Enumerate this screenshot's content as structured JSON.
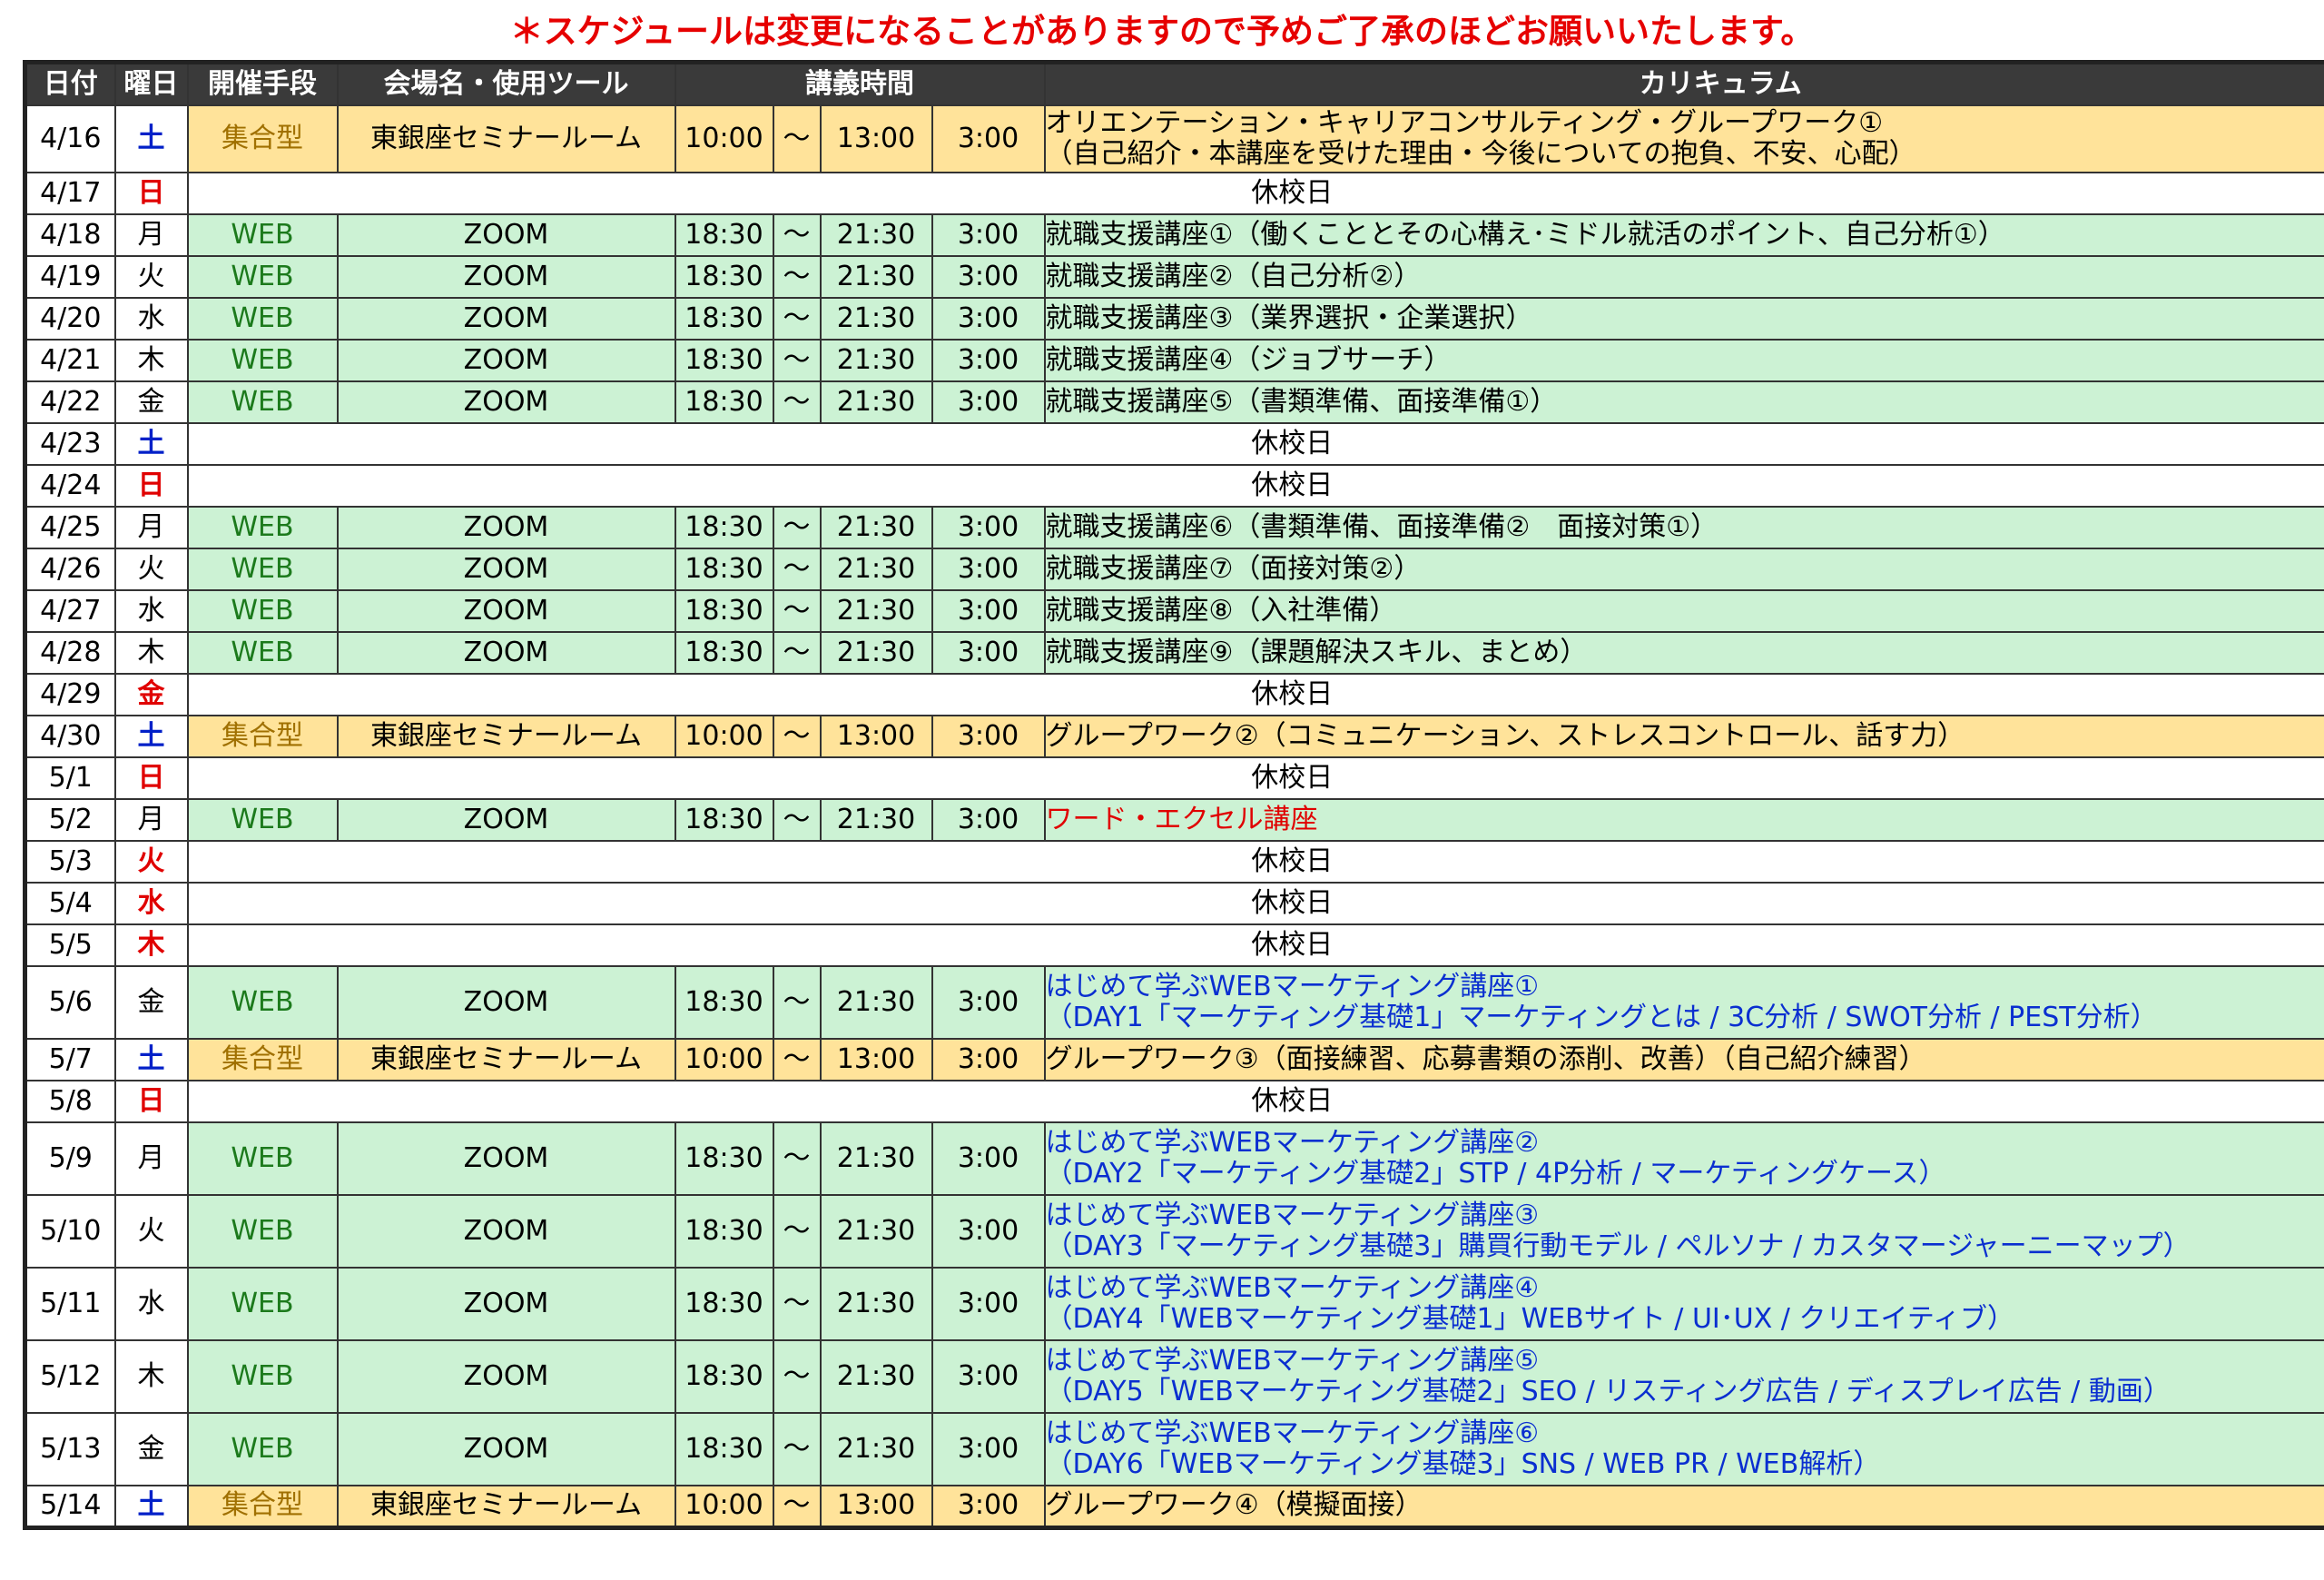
{
  "notice": "＊スケジュールは変更になることがありますので予めご了承のほどお願いいたします。",
  "headers": {
    "date": "日付",
    "day": "曜日",
    "mode": "開催手段",
    "venue": "会場名・使用ツール",
    "time": "講義時間",
    "curriculum": "カリキュラム"
  },
  "rows": [
    {
      "date": "4/16",
      "day": "土",
      "dayType": "sat",
      "type": "meet",
      "mode": "集合型",
      "venue": "東銀座セミナールーム",
      "start": "10:00",
      "tilde": "〜",
      "end": "13:00",
      "dur": "3:00",
      "cur": [
        "オリエンテーション・キャリアコンサルティング・グループワーク①",
        "（自己紹介・本講座を受けた理由・今後についての抱負、不安、心配）"
      ]
    },
    {
      "date": "4/17",
      "day": "日",
      "dayType": "sun",
      "type": "holiday",
      "holiday": "休校日"
    },
    {
      "date": "4/18",
      "day": "月",
      "dayType": "wk",
      "type": "web",
      "mode": "WEB",
      "venue": "ZOOM",
      "start": "18:30",
      "tilde": "〜",
      "end": "21:30",
      "dur": "3:00",
      "cur": [
        "就職支援講座①（働くこととその心構え･ミドル就活のポイント、自己分析①）"
      ]
    },
    {
      "date": "4/19",
      "day": "火",
      "dayType": "wk",
      "type": "web",
      "mode": "WEB",
      "venue": "ZOOM",
      "start": "18:30",
      "tilde": "〜",
      "end": "21:30",
      "dur": "3:00",
      "cur": [
        "就職支援講座②（自己分析②）"
      ]
    },
    {
      "date": "4/20",
      "day": "水",
      "dayType": "wk",
      "type": "web",
      "mode": "WEB",
      "venue": "ZOOM",
      "start": "18:30",
      "tilde": "〜",
      "end": "21:30",
      "dur": "3:00",
      "cur": [
        "就職支援講座③（業界選択・企業選択）"
      ]
    },
    {
      "date": "4/21",
      "day": "木",
      "dayType": "wk",
      "type": "web",
      "mode": "WEB",
      "venue": "ZOOM",
      "start": "18:30",
      "tilde": "〜",
      "end": "21:30",
      "dur": "3:00",
      "cur": [
        "就職支援講座④（ジョブサーチ）"
      ]
    },
    {
      "date": "4/22",
      "day": "金",
      "dayType": "wk",
      "type": "web",
      "mode": "WEB",
      "venue": "ZOOM",
      "start": "18:30",
      "tilde": "〜",
      "end": "21:30",
      "dur": "3:00",
      "cur": [
        "就職支援講座⑤（書類準備、面接準備①）"
      ]
    },
    {
      "date": "4/23",
      "day": "土",
      "dayType": "sat",
      "type": "holiday",
      "holiday": "休校日"
    },
    {
      "date": "4/24",
      "day": "日",
      "dayType": "sun",
      "type": "holiday",
      "holiday": "休校日"
    },
    {
      "date": "4/25",
      "day": "月",
      "dayType": "wk",
      "type": "web",
      "mode": "WEB",
      "venue": "ZOOM",
      "start": "18:30",
      "tilde": "〜",
      "end": "21:30",
      "dur": "3:00",
      "cur": [
        "就職支援講座⑥（書類準備、面接準備②　面接対策①）"
      ]
    },
    {
      "date": "4/26",
      "day": "火",
      "dayType": "wk",
      "type": "web",
      "mode": "WEB",
      "venue": "ZOOM",
      "start": "18:30",
      "tilde": "〜",
      "end": "21:30",
      "dur": "3:00",
      "cur": [
        "就職支援講座⑦（面接対策②）"
      ]
    },
    {
      "date": "4/27",
      "day": "水",
      "dayType": "wk",
      "type": "web",
      "mode": "WEB",
      "venue": "ZOOM",
      "start": "18:30",
      "tilde": "〜",
      "end": "21:30",
      "dur": "3:00",
      "cur": [
        "就職支援講座⑧（入社準備）"
      ]
    },
    {
      "date": "4/28",
      "day": "木",
      "dayType": "wk",
      "type": "web",
      "mode": "WEB",
      "venue": "ZOOM",
      "start": "18:30",
      "tilde": "〜",
      "end": "21:30",
      "dur": "3:00",
      "cur": [
        "就職支援講座⑨（課題解決スキル、まとめ）"
      ]
    },
    {
      "date": "4/29",
      "day": "金",
      "dayType": "sun",
      "type": "holiday",
      "holiday": "休校日"
    },
    {
      "date": "4/30",
      "day": "土",
      "dayType": "sat",
      "type": "meet",
      "mode": "集合型",
      "venue": "東銀座セミナールーム",
      "start": "10:00",
      "tilde": "〜",
      "end": "13:00",
      "dur": "3:00",
      "cur": [
        "グループワーク②（コミュニケーション、ストレスコントロール、話す力）"
      ]
    },
    {
      "date": "5/1",
      "day": "日",
      "dayType": "sun",
      "type": "holiday",
      "holiday": "休校日"
    },
    {
      "date": "5/2",
      "day": "月",
      "dayType": "wk",
      "type": "web",
      "mode": "WEB",
      "venue": "ZOOM",
      "start": "18:30",
      "tilde": "〜",
      "end": "21:30",
      "dur": "3:00",
      "curColor": "red",
      "cur": [
        "ワード・エクセル講座"
      ]
    },
    {
      "date": "5/3",
      "day": "火",
      "dayType": "sun",
      "type": "holiday",
      "holiday": "休校日"
    },
    {
      "date": "5/4",
      "day": "水",
      "dayType": "sun",
      "type": "holiday",
      "holiday": "休校日"
    },
    {
      "date": "5/5",
      "day": "木",
      "dayType": "sun",
      "type": "holiday",
      "holiday": "休校日"
    },
    {
      "date": "5/6",
      "day": "金",
      "dayType": "wk",
      "type": "web",
      "mode": "WEB",
      "venue": "ZOOM",
      "start": "18:30",
      "tilde": "〜",
      "end": "21:30",
      "dur": "3:00",
      "curColor": "blue",
      "cur": [
        "はじめて学ぶWEBマーケティング講座①",
        "（DAY1「マーケティング基礎1」マーケティングとは / 3C分析 / SWOT分析 / PEST分析）"
      ]
    },
    {
      "date": "5/7",
      "day": "土",
      "dayType": "sat",
      "type": "meet",
      "mode": "集合型",
      "venue": "東銀座セミナールーム",
      "start": "10:00",
      "tilde": "〜",
      "end": "13:00",
      "dur": "3:00",
      "cur": [
        "グループワーク③（面接練習、応募書類の添削、改善）（自己紹介練習）"
      ]
    },
    {
      "date": "5/8",
      "day": "日",
      "dayType": "sun",
      "type": "holiday",
      "holiday": "休校日"
    },
    {
      "date": "5/9",
      "day": "月",
      "dayType": "wk",
      "type": "web",
      "mode": "WEB",
      "venue": "ZOOM",
      "start": "18:30",
      "tilde": "〜",
      "end": "21:30",
      "dur": "3:00",
      "curColor": "blue",
      "cur": [
        "はじめて学ぶWEBマーケティング講座②",
        "（DAY2「マーケティング基礎2」STP / 4P分析 / マーケティングケース）"
      ]
    },
    {
      "date": "5/10",
      "day": "火",
      "dayType": "wk",
      "type": "web",
      "mode": "WEB",
      "venue": "ZOOM",
      "start": "18:30",
      "tilde": "〜",
      "end": "21:30",
      "dur": "3:00",
      "curColor": "blue",
      "cur": [
        "はじめて学ぶWEBマーケティング講座③",
        "（DAY3「マーケティング基礎3」購買行動モデル / ペルソナ / カスタマージャーニーマップ）"
      ]
    },
    {
      "date": "5/11",
      "day": "水",
      "dayType": "wk",
      "type": "web",
      "mode": "WEB",
      "venue": "ZOOM",
      "start": "18:30",
      "tilde": "〜",
      "end": "21:30",
      "dur": "3:00",
      "curColor": "blue",
      "cur": [
        "はじめて学ぶWEBマーケティング講座④",
        "（DAY4「WEBマーケティング基礎1」WEBサイト / UI･UX / クリエイティブ）"
      ]
    },
    {
      "date": "5/12",
      "day": "木",
      "dayType": "wk",
      "type": "web",
      "mode": "WEB",
      "venue": "ZOOM",
      "start": "18:30",
      "tilde": "〜",
      "end": "21:30",
      "dur": "3:00",
      "curColor": "blue",
      "cur": [
        "はじめて学ぶWEBマーケティング講座⑤",
        "（DAY5「WEBマーケティング基礎2」SEO / リスティング広告 / ディスプレイ広告 / 動画）"
      ]
    },
    {
      "date": "5/13",
      "day": "金",
      "dayType": "wk",
      "type": "web",
      "mode": "WEB",
      "venue": "ZOOM",
      "start": "18:30",
      "tilde": "〜",
      "end": "21:30",
      "dur": "3:00",
      "curColor": "blue",
      "cur": [
        "はじめて学ぶWEBマーケティング講座⑥",
        "（DAY6「WEBマーケティング基礎3」SNS / WEB PR / WEB解析）"
      ]
    },
    {
      "date": "5/14",
      "day": "土",
      "dayType": "sat",
      "type": "meet",
      "mode": "集合型",
      "venue": "東銀座セミナールーム",
      "start": "10:00",
      "tilde": "〜",
      "end": "13:00",
      "dur": "3:00",
      "cur": [
        "グループワーク④（模擬面接）"
      ]
    }
  ],
  "colors": {
    "web_row": "#ccf2d4",
    "meet_row": "#ffe39a",
    "header_bg": "#3a3a3a",
    "saturday": "#0020c8",
    "holiday": "#e00000",
    "notice": "#e60000"
  }
}
